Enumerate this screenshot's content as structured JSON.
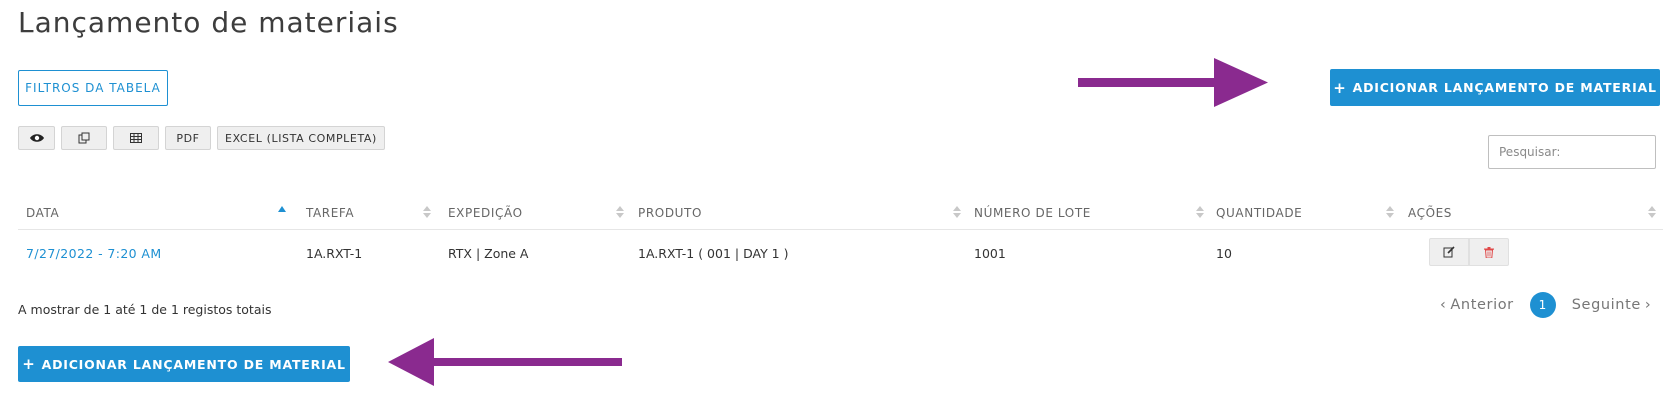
{
  "page": {
    "title": "Lançamento de materiais"
  },
  "filters_button": {
    "label": "FILTROS DA TABELA"
  },
  "add_button": {
    "label": "ADICIONAR LANÇAMENTO DE MATERIAL",
    "icon": "plus-icon"
  },
  "toolbar": {
    "buttons": [
      {
        "icon": "eye-icon"
      },
      {
        "icon": "copy-icon"
      },
      {
        "icon": "table-icon"
      },
      {
        "label": "PDF"
      },
      {
        "label": "EXCEL (LISTA COMPLETA)"
      }
    ]
  },
  "search": {
    "placeholder": "Pesquisar:"
  },
  "table": {
    "columns": [
      "DATA",
      "TAREFA",
      "EXPEDIÇÃO",
      "PRODUTO",
      "NÚMERO DE LOTE",
      "QUANTIDADE",
      "AÇÕES"
    ],
    "sorted_column": "DATA",
    "rows": [
      {
        "data": "7/27/2022 - 7:20 AM",
        "tarefa": "1A.RXT-1",
        "expedicao": "RTX | Zone A",
        "produto": "1A.RXT-1 ( 001 | DAY 1 )",
        "lote": "1001",
        "quantidade": "10"
      }
    ]
  },
  "info": {
    "text": "A mostrar de 1 até 1 de 1 registos totais"
  },
  "pagination": {
    "previous": "Anterior",
    "current": "1",
    "next": "Seguinte"
  },
  "colors": {
    "accent": "#1e90d2",
    "arrow": "#8a2a8f",
    "delete": "#e04848"
  }
}
